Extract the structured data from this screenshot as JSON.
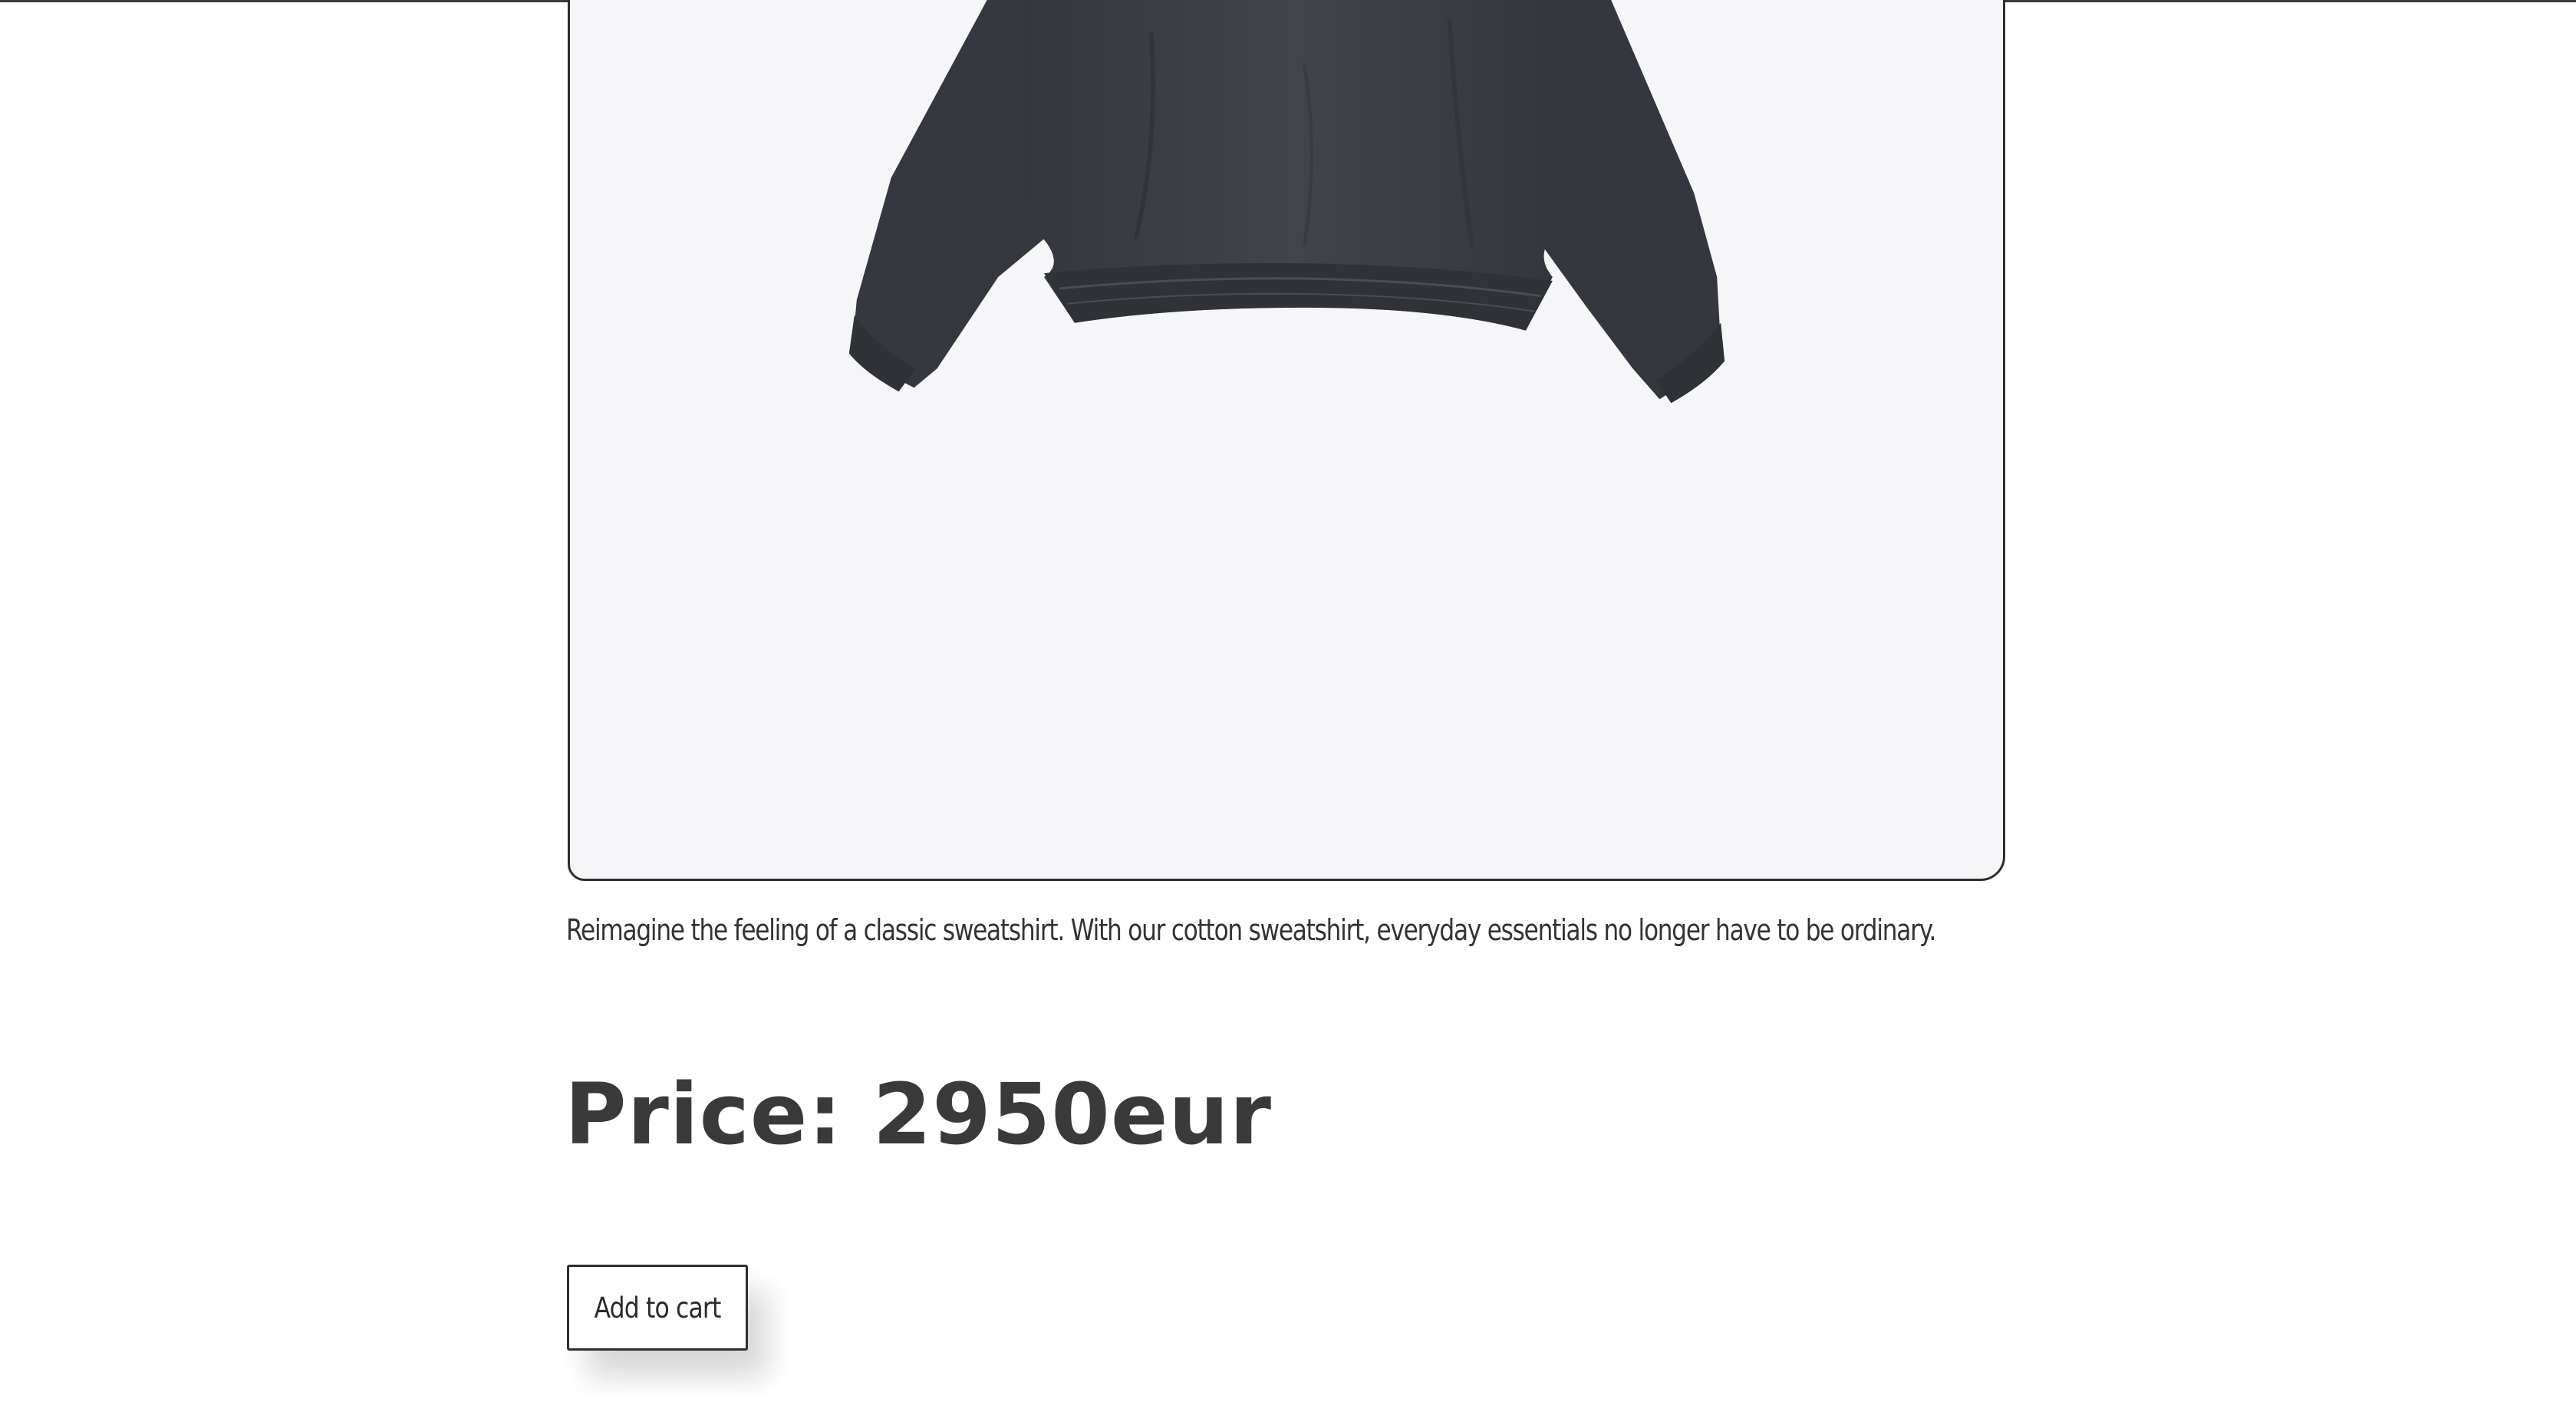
{
  "product": {
    "image_alt": "sweatshirt",
    "description": "Reimagine the feeling of a classic sweatshirt. With our cotton sweatshirt, everyday essentials no longer have to be ordinary.",
    "price_label": "Price: 2950eur",
    "add_to_cart_label": "Add to cart"
  },
  "colors": {
    "card_background": "#f6f6f8",
    "garment": "#3c3f45",
    "text": "#333333"
  }
}
